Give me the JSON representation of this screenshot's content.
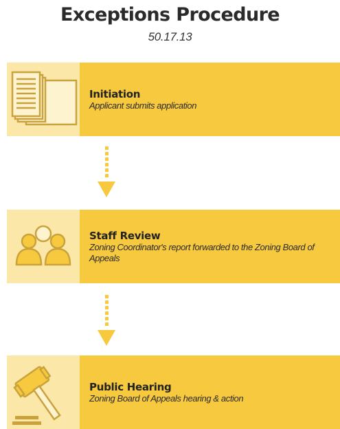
{
  "header": {
    "title": "Exceptions Procedure",
    "subtitle": "50.17.13"
  },
  "steps": [
    {
      "label": "Initiation",
      "description": "Applicant submits application",
      "icon": "documents-icon"
    },
    {
      "label": "Staff Review",
      "description": "Zoning Coordinator's report forwarded to the Zoning Board of Appeals",
      "icon": "people-group-icon"
    },
    {
      "label": "Public Hearing",
      "description": "Zoning Board of Appeals hearing & action",
      "icon": "gavel-icon"
    }
  ],
  "colors": {
    "accent": "#f7c93e",
    "icon_panel": "#fbe8a9",
    "icon_stroke": "#c9a23c",
    "arrow": "#f7c93e"
  }
}
